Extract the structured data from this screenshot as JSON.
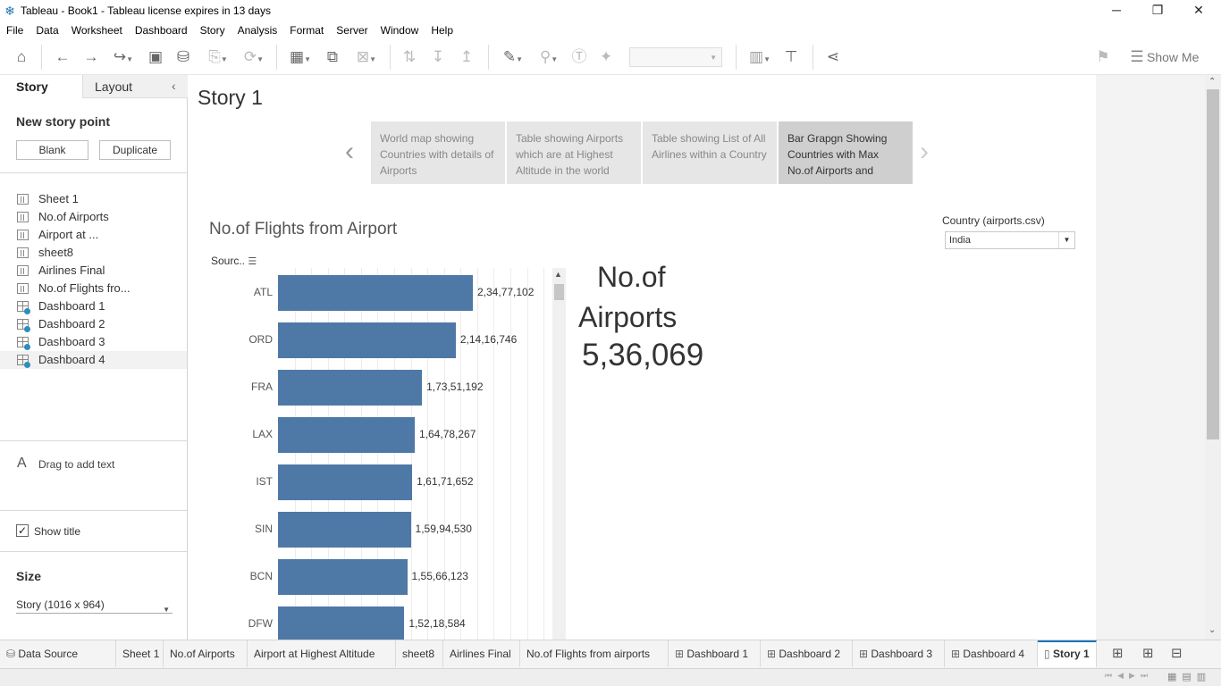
{
  "window": {
    "title": "Tableau - Book1 - Tableau license expires in 13 days",
    "minimize": "─",
    "restore": "❐",
    "close": "✕"
  },
  "menu": [
    "File",
    "Data",
    "Worksheet",
    "Dashboard",
    "Story",
    "Analysis",
    "Format",
    "Server",
    "Window",
    "Help"
  ],
  "toolbar": {
    "show_me": "Show Me"
  },
  "left_pane": {
    "tabs": [
      "Story",
      "Layout"
    ],
    "new_story_point": "New story point",
    "blank_button": "Blank",
    "duplicate_button": "Duplicate",
    "sheets": [
      {
        "label": "Sheet 1",
        "kind": "sheet"
      },
      {
        "label": "No.of Airports",
        "kind": "sheet"
      },
      {
        "label": "Airport  at ...",
        "kind": "sheet"
      },
      {
        "label": "sheet8",
        "kind": "sheet"
      },
      {
        "label": "Airlines Final",
        "kind": "sheet"
      },
      {
        "label": "No.of Flights fro...",
        "kind": "sheet"
      },
      {
        "label": "Dashboard 1",
        "kind": "dashboard"
      },
      {
        "label": "Dashboard 2",
        "kind": "dashboard"
      },
      {
        "label": "Dashboard 3",
        "kind": "dashboard"
      },
      {
        "label": "Dashboard 4",
        "kind": "dashboard"
      }
    ],
    "drag_text": "Drag to add text",
    "show_title": "Show title",
    "show_title_checked": true,
    "size_heading": "Size",
    "size_value": "Story (1016 x 964)"
  },
  "story": {
    "title": "Story 1",
    "points": [
      "World map showing Countries with details of Airports",
      "Table showing Airports which are at Highest Altitude in the world",
      "Table showing List of All Airlines within a Country",
      "Bar Grapgn Showing Countries with Max No.of Airports and"
    ],
    "active_point": 3,
    "filter_label": "Country (airports.csv)",
    "filter_value": "India",
    "chart_title": "No.of Flights from Airport",
    "sort_label": "Sourc..",
    "kpi_label_line1": "No.of",
    "kpi_label_line2": "Airports",
    "kpi_value": "5,36,069"
  },
  "chart_data": {
    "type": "bar",
    "title": "No.of Flights from Airport",
    "ylabel": "Sourc..",
    "categories": [
      "ATL",
      "ORD",
      "FRA",
      "LAX",
      "IST",
      "SIN",
      "BCN",
      "DFW"
    ],
    "values": [
      23477102,
      21416746,
      17351192,
      16478267,
      16171652,
      15994530,
      15566123,
      15218584
    ],
    "labels": [
      "2,34,77,102",
      "2,14,16,746",
      "1,73,51,192",
      "1,64,78,267",
      "1,61,71,652",
      "1,59,94,530",
      "1,55,66,123",
      "1,52,18,584"
    ],
    "color": "#4e79a7"
  },
  "tabs": [
    {
      "label": "Data Source",
      "kind": "datasource"
    },
    {
      "label": "Sheet 1",
      "kind": "sheet"
    },
    {
      "label": "No.of Airports",
      "kind": "sheet"
    },
    {
      "label": "Airport  at Highest Altitude",
      "kind": "sheet"
    },
    {
      "label": "sheet8",
      "kind": "sheet"
    },
    {
      "label": "Airlines Final",
      "kind": "sheet"
    },
    {
      "label": "No.of Flights from airports",
      "kind": "sheet"
    },
    {
      "label": "Dashboard 1",
      "kind": "dashboard"
    },
    {
      "label": "Dashboard 2",
      "kind": "dashboard"
    },
    {
      "label": "Dashboard 3",
      "kind": "dashboard"
    },
    {
      "label": "Dashboard 4",
      "kind": "dashboard"
    },
    {
      "label": "Story 1",
      "kind": "story",
      "active": true
    }
  ],
  "colors": {
    "accent": "#1b75bc",
    "bar": "#4e79a7",
    "badge": "#2a8fbd"
  }
}
